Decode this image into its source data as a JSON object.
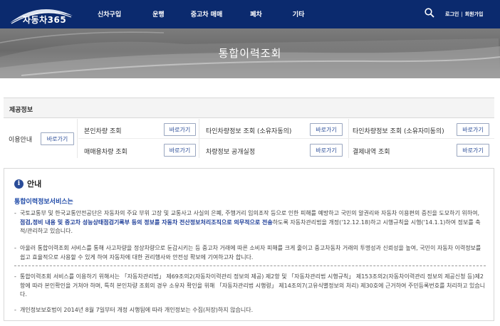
{
  "header": {
    "logo_text": "자동차365",
    "nav": [
      "신차구입",
      "운행",
      "중고차 매매",
      "폐차",
      "기타"
    ],
    "search_icon": "search-icon",
    "login": "로그인",
    "separator": "|",
    "signup": "회원가입"
  },
  "banner": {
    "title": "통합이력조회"
  },
  "provided_info": {
    "heading": "제공정보",
    "usage_label": "이용안내",
    "view_label": "바로가기",
    "row1": [
      "본인차량 조회",
      "타인차량정보 조회 (소유자동의)",
      "타인차량정보 조회 (소유자미동의)"
    ],
    "row2": [
      "매매용차량 조회",
      "차량정보 공개실정",
      "결제내역 조회"
    ]
  },
  "notice": {
    "title": "안내",
    "info_icon": "i",
    "service_title": "통합이력정보서비스는",
    "dash": "-",
    "p1_a": "국토교통부 및 한국교통안전공단은 자동차의 주요 부위 고장 및 교통사고 사실의 은폐, 주행거리 임의조작 등으로 인한 피해를 예방하고 국민의 알권리와 자동차 이용편의 증진을 도모하기 위하여, ",
    "p1_hl": "점검,정비 내용 및 중고차 성능상태점검기록부 등의 정보를 자동차 전산정보처리조직으로 의무적으로 전송",
    "p1_b": "하도록 자동차관리법을 개정('12.12.18)하고 시행규칙을 시행('14.1.1)하여 정보를 축적/관리하고 있습니다.",
    "p2": "아울러 통합이력조회 서비스를 통해 사고차량을 정상차량으로 둔갑시키는 등 중고차 거래에 따른 소비자 피해를 크게 줄이고 중고차동차 거래의 투명성과 신뢰성을 높여, 국민이 자동차 이력정보를 쉽고 효율적으로 사용할 수 있게 하여 자동차에 대한 권리행사와 안전성 확보에 기여하고자 합니다.",
    "p3": "통합이력조회 서비스를 이용하기 위해서는 「자동차관리법」 제69조의2(자동차이력관리 정보의 제공) 제2항 및 「자동차관리법 시행규칙」 제153조의2(자동차이력관리 정보의 제공신청 등)제2항에 따라 본인확인을 거쳐야 하며, 특히 본인차량 조회의 경우 소유자 확인을 위해 「자동차관리법 시행령」 제14조의7(고유식별정보의 처리) 제30호에 근거하여 주민등록번호를 처리하고 있습니다.",
    "p4": "개인정보보호법이 2014년 8월 7일부터 개정 시행됨에 따라 개인정보는 수집(저장)하지 않습니다."
  }
}
